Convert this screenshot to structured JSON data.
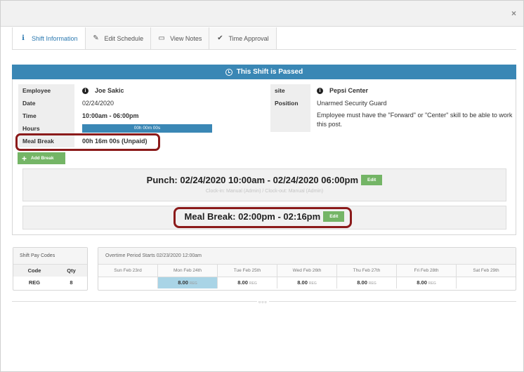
{
  "modal": {
    "close_glyph": "×"
  },
  "tabs": [
    {
      "label": "Shift Information",
      "icon": "info-icon",
      "active": true
    },
    {
      "label": "Edit Schedule",
      "icon": "pencil-icon",
      "active": false
    },
    {
      "label": "View Notes",
      "icon": "book-icon",
      "active": false
    },
    {
      "label": "Time Approval",
      "icon": "check-icon",
      "active": false
    }
  ],
  "banner": {
    "text": "This Shift is Passed",
    "icon": "clock-icon",
    "color": "#3a87b5"
  },
  "shift": {
    "employee_label": "Employee",
    "employee": "Joe Sakic",
    "date_label": "Date",
    "date": "02/24/2020",
    "time_label": "Time",
    "time": "10:00am - 06:00pm",
    "hours_label": "Hours",
    "hours": "00h 00m 00s",
    "meal_label": "Meal Break",
    "meal": "00h 16m 00s (Unpaid)",
    "site_label": "site",
    "site": "Pepsi Center",
    "position_label": "Position",
    "position": "Unarmed Security Guard",
    "note": "Employee must have the \"Forward\" or \"Center\" skill to be able to work this post."
  },
  "add_break": {
    "label": "Add Break",
    "icon": "plus-icon",
    "color": "#74b566"
  },
  "punch": {
    "title": "Punch: 02/24/2020 10:00am - 02/24/2020 06:00pm",
    "edit_label": "Edit",
    "sub": "Clock-in: Manual (Admin)  /  Clock-out: Manual (Admin)"
  },
  "meal_break": {
    "title": "Meal Break: 02:00pm - 02:16pm",
    "edit_label": "Edit"
  },
  "pay_codes": {
    "title": "Shift Pay Codes",
    "headers": [
      "Code",
      "Qty"
    ],
    "rows": [
      [
        "REG",
        "8"
      ]
    ]
  },
  "overtime": {
    "title": "Overtime Period Starts 02/23/2020 12:00am",
    "days": [
      "Sun Feb 23rd",
      "Mon Feb 24th",
      "Tue Feb 25th",
      "Wed Feb 26th",
      "Thu Feb 27th",
      "Fri Feb 28th",
      "Sat Feb 29th"
    ],
    "values": [
      "",
      "8.00",
      "8.00",
      "8.00",
      "8.00",
      "8.00",
      ""
    ],
    "unit": "REG",
    "highlight_index": 1
  },
  "footer": {
    "dots": "▫▫▫"
  },
  "colors": {
    "accent": "#3a87b5",
    "green": "#74b566",
    "highlight_border": "#8b1a1a"
  }
}
